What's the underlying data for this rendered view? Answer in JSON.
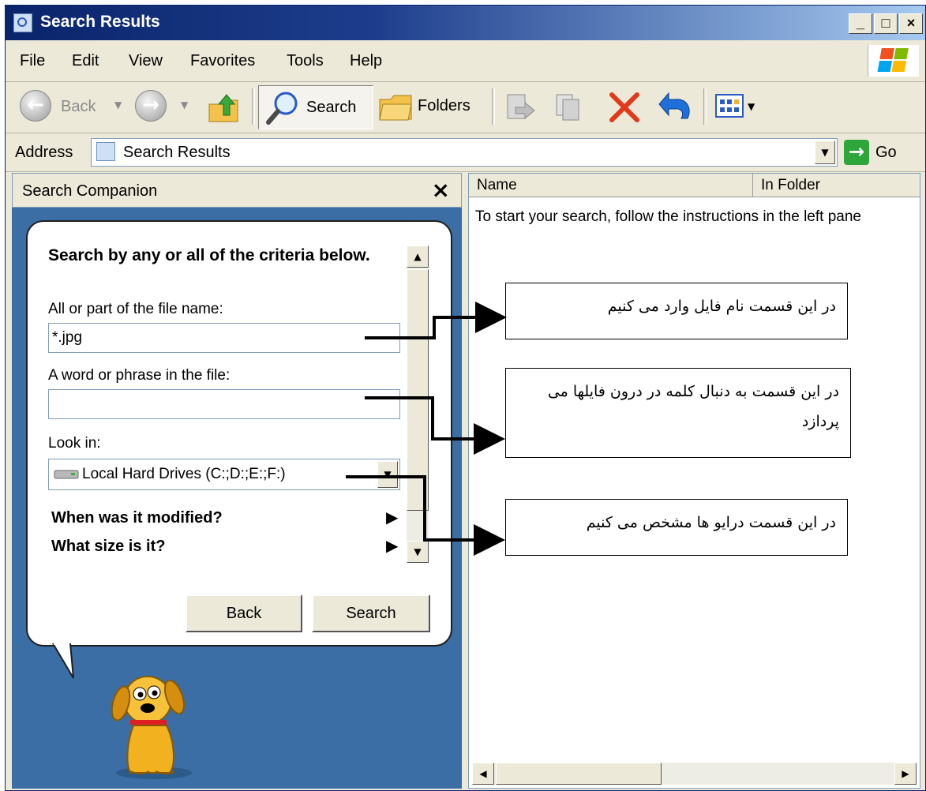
{
  "window": {
    "title": "Search Results",
    "min_label": "_",
    "max_label": "□",
    "close_label": "×"
  },
  "menu": [
    "File",
    "Edit",
    "View",
    "Favorites",
    "Tools",
    "Help"
  ],
  "toolbar": {
    "back": "Back",
    "search": "Search",
    "folders": "Folders"
  },
  "address": {
    "label": "Address",
    "value": "Search Results",
    "go": "Go"
  },
  "search_companion": {
    "header": "Search Companion",
    "close": "×",
    "heading": "Search by any or all of the criteria below.",
    "filename_label": "All or part of the file name:",
    "filename_value": "*.jpg",
    "phrase_label": "A word or phrase in the file:",
    "phrase_value": "",
    "lookin_label": "Look in:",
    "lookin_value": "Local Hard Drives (C:;D:;E:;F:)",
    "modified": "When was it modified?",
    "size": "What size is it?",
    "back_button": "Back",
    "search_button": "Search"
  },
  "results": {
    "columns": [
      "Name",
      "In Folder"
    ],
    "message": "To start your search, follow the instructions in the left pane"
  },
  "annotations": [
    "در این قسمت نام فایل وارد می کنیم",
    "در این قسمت به دنبال کلمه در درون فایلها می پردازد",
    "در این قسمت درایو ها مشخص می کنیم"
  ],
  "colors": {
    "title_bar": "#0a246a",
    "pane_background": "#3b6ea5",
    "chrome": "#ece9d8",
    "delete_x": "#e03a1a"
  }
}
